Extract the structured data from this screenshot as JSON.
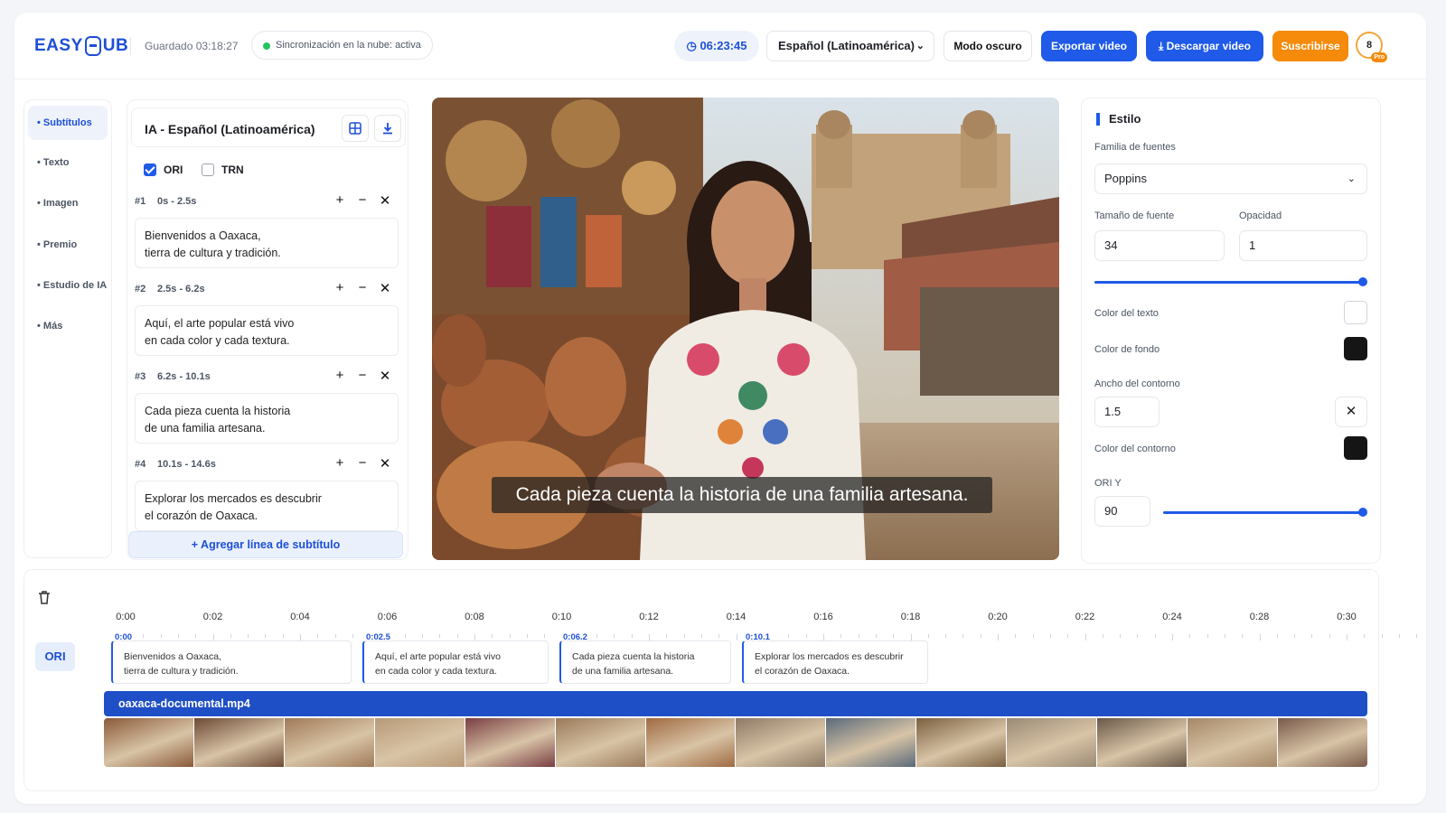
{
  "header": {
    "logo": {
      "left": "EASY",
      "right": "UB"
    },
    "saved": "Guardado 03:18:27",
    "sync": "Sincronización en la nube: activa",
    "timer": "06:23:45",
    "language": "Español (Latinoamérica)",
    "dark_mode": "Modo oscuro",
    "export": "Exportar video",
    "download": "Descargar video",
    "subscribe": "Suscribirse",
    "avatar_count": "8",
    "avatar_badge": "Pro"
  },
  "nav": {
    "items": [
      "Subtítulos",
      "Texto",
      "Imagen",
      "Premio",
      "Estudio de IA",
      "Más"
    ],
    "active": "Subtítulos"
  },
  "subtitles": {
    "title": "IA - Español (Latinoamérica)",
    "checks": [
      {
        "label": "ORI",
        "checked": true
      },
      {
        "label": "TRN",
        "checked": false
      }
    ],
    "segments": [
      {
        "num": "#1",
        "range": "0s - 2.5s",
        "line1": "Bienvenidos a Oaxaca,",
        "line2": "tierra de cultura y tradición."
      },
      {
        "num": "#2",
        "range": "2.5s - 6.2s",
        "line1": "Aquí, el arte popular está vivo",
        "line2": "en cada color y cada textura."
      },
      {
        "num": "#3",
        "range": "6.2s - 10.1s",
        "line1": "Cada pieza cuenta la historia",
        "line2": "de una familia artesana."
      },
      {
        "num": "#4",
        "range": "10.1s - 14.6s",
        "line1": "Explorar los mercados es descubrir",
        "line2": "el corazón de Oaxaca."
      }
    ],
    "add_line": "+ Agregar línea de subtítulo"
  },
  "video": {
    "caption": "Cada pieza cuenta la historia de una familia artesana."
  },
  "style": {
    "title": "Estilo",
    "font_family_label": "Familia de fuentes",
    "font_family": "Poppins",
    "font_size_label": "Tamaño de fuente",
    "font_size": "34",
    "opacity_label": "Opacidad",
    "opacity": "1",
    "text_color_label": "Color del texto",
    "text_color": "#ffffff",
    "bg_color_label": "Color de fondo",
    "bg_color": "#151515",
    "outline_width_label": "Ancho del contorno",
    "outline_width": "1.5",
    "outline_color_label": "Color del contorno",
    "outline_color": "#151515",
    "ori_y_label": "ORI Y",
    "ori_y": "90"
  },
  "timeline": {
    "ticks": [
      "0:00",
      "0:02",
      "0:04",
      "0:06",
      "0:08",
      "0:10",
      "0:12",
      "0:14",
      "0:16",
      "0:18",
      "0:20",
      "0:22",
      "0:24",
      "0:28",
      "0:30"
    ],
    "track_label": "ORI",
    "captions": [
      {
        "time": "0:00",
        "line1": "Bienvenidos a Oaxaca,",
        "line2": "tierra de cultura y tradición."
      },
      {
        "time": "0:02.5",
        "line1": "Aquí, el arte popular está vivo",
        "line2": "en cada color y cada textura."
      },
      {
        "time": "0:06.2",
        "line1": "Cada pieza cuenta la historia",
        "line2": "de una familia artesana."
      },
      {
        "time": "0:10.1",
        "line1": "Explorar los mercados es descubrir",
        "line2": "el corazón de Oaxaca."
      }
    ],
    "video_file": "oaxaca-documental.mp4"
  },
  "colors": {
    "accent": "#1f5ae8",
    "orange": "#f58a0b"
  }
}
